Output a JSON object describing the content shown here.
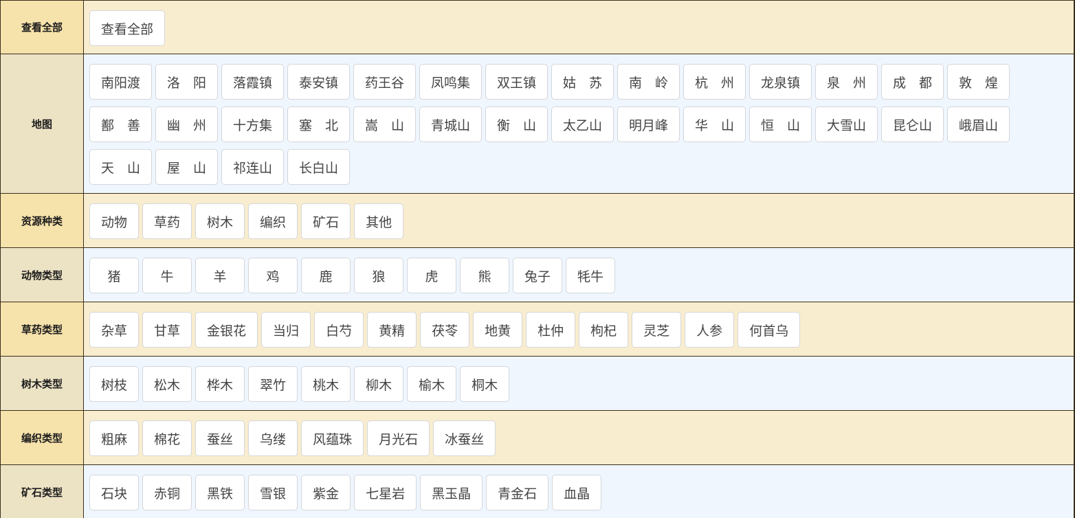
{
  "rows": [
    {
      "label": "查看全部",
      "items": [
        "查看全部"
      ]
    },
    {
      "label": "地图",
      "items": [
        "南阳渡",
        "洛　阳",
        "落霞镇",
        "泰安镇",
        "药王谷",
        "凤鸣集",
        "双王镇",
        "姑　苏",
        "南　岭",
        "杭　州",
        "龙泉镇",
        "泉　州",
        "成　都",
        "敦　煌",
        "鄯　善",
        "幽　州",
        "十方集",
        "塞　北",
        "嵩　山",
        "青城山",
        "衡　山",
        "太乙山",
        "明月峰",
        "华　山",
        "恒　山",
        "大雪山",
        "昆仑山",
        "峨眉山",
        "天　山",
        "屋　山",
        "祁连山",
        "长白山"
      ]
    },
    {
      "label": "资源种类",
      "items": [
        "动物",
        "草药",
        "树木",
        "编织",
        "矿石",
        "其他"
      ]
    },
    {
      "label": "动物类型",
      "items": [
        "猪",
        "牛",
        "羊",
        "鸡",
        "鹿",
        "狼",
        "虎",
        "熊",
        "兔子",
        "牦牛"
      ]
    },
    {
      "label": "草药类型",
      "items": [
        "杂草",
        "甘草",
        "金银花",
        "当归",
        "白芍",
        "黄精",
        "茯苓",
        "地黄",
        "杜仲",
        "枸杞",
        "灵芝",
        "人参",
        "何首乌"
      ]
    },
    {
      "label": "树木类型",
      "items": [
        "树枝",
        "松木",
        "桦木",
        "翠竹",
        "桃木",
        "柳木",
        "榆木",
        "桐木"
      ]
    },
    {
      "label": "编织类型",
      "items": [
        "粗麻",
        "棉花",
        "蚕丝",
        "乌缕",
        "风蕴珠",
        "月光石",
        "冰蚕丝"
      ]
    },
    {
      "label": "矿石类型",
      "items": [
        "石块",
        "赤铜",
        "黑铁",
        "雪银",
        "紫金",
        "七星岩",
        "黑玉晶",
        "青金石",
        "血晶"
      ]
    }
  ],
  "colors": {
    "label_bg_odd": "#f6e2ab",
    "content_bg_odd": "#f9edcf",
    "label_bg_even": "#ece2c4",
    "content_bg_even": "#eff6fe",
    "border": "#3a2e1a"
  }
}
